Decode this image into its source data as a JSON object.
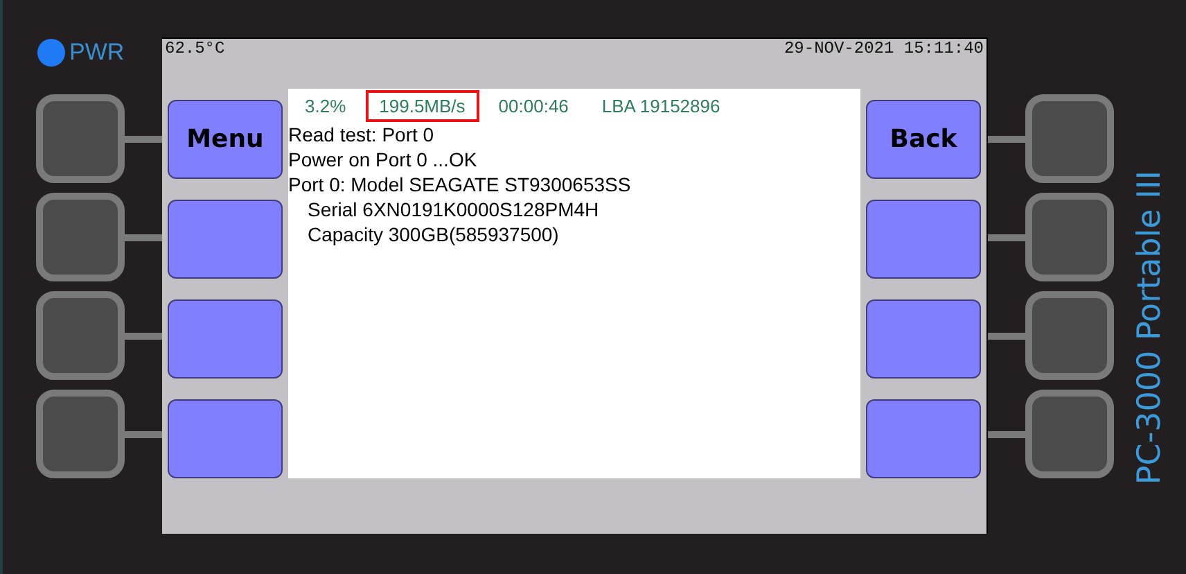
{
  "power_indicator": {
    "label": "PWR",
    "on": true
  },
  "screen": {
    "temperature": "62.5°C",
    "datetime": "29-NOV-2021 15:11:40",
    "left_softkeys": [
      {
        "kind": "labeled",
        "label": "Menu"
      },
      {
        "kind": "blank"
      },
      {
        "kind": "blank"
      },
      {
        "kind": "blank"
      }
    ],
    "status": [
      {
        "text": "3.2%",
        "highlighted": false
      },
      {
        "text": "199.5MB/s",
        "highlighted": true
      },
      {
        "text": "00:00:46",
        "highlighted": false
      },
      {
        "text": "LBA 19152896",
        "highlighted": false
      }
    ],
    "log": [
      {
        "text": "Read test: Port 0",
        "indented": false
      },
      {
        "text": "Power on Port 0 ...OK",
        "indented": false
      },
      {
        "text": "Port 0: Model SEAGATE ST9300653SS",
        "indented": false
      },
      {
        "text": "Serial 6XN0191K0000S128PM4H",
        "indented": true
      },
      {
        "text": "Capacity 300GB(585937500)",
        "indented": true
      }
    ],
    "right_softkeys": [
      {
        "kind": "labeled",
        "label": "Back"
      },
      {
        "kind": "blank"
      },
      {
        "kind": "blank"
      },
      {
        "kind": "blank"
      }
    ]
  },
  "brand": "PC-3000 Portable III"
}
